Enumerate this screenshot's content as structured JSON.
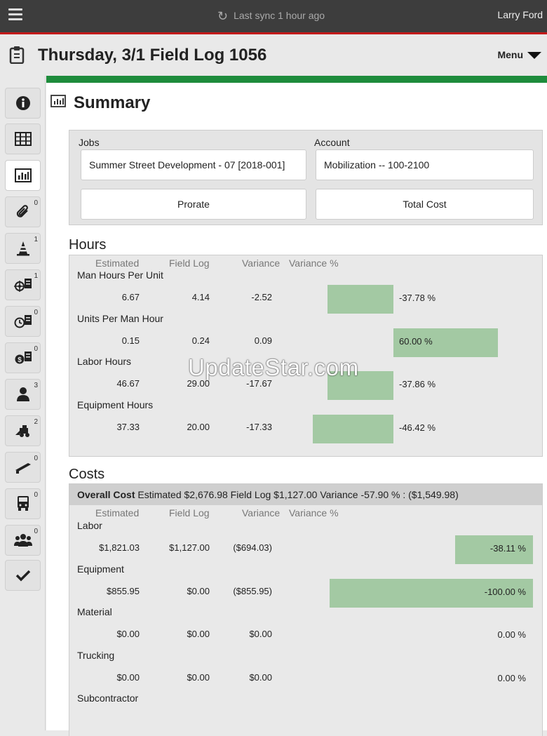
{
  "topbar": {
    "sync_text": "Last sync 1 hour ago",
    "user": "Larry Ford"
  },
  "header": {
    "title": "Thursday, 3/1 Field Log 1056",
    "menu_label": "Menu"
  },
  "sidebar": {
    "badges": [
      "0",
      "1",
      "1",
      "0",
      "0",
      "3",
      "2",
      "0",
      "0",
      "0"
    ]
  },
  "summary": {
    "title": "Summary"
  },
  "filters": {
    "jobs_label": "Jobs",
    "jobs_value": "Summer Street Development - 07 [2018-001]",
    "account_label": "Account",
    "account_value": "Mobilization -- 100-2100",
    "prorate_label": "Prorate",
    "total_cost_label": "Total Cost"
  },
  "columns": {
    "estimated": "Estimated",
    "field_log": "Field Log",
    "variance": "Variance",
    "variance_pct": "Variance %"
  },
  "hours": {
    "title": "Hours",
    "rows": [
      {
        "label": "Man Hours Per Unit",
        "estimated": "6.67",
        "field_log": "4.14",
        "variance": "-2.52",
        "pct": "-37.78 %",
        "pct_value": -37.78
      },
      {
        "label": "Units Per Man Hour",
        "estimated": "0.15",
        "field_log": "0.24",
        "variance": "0.09",
        "pct": "60.00 %",
        "pct_value": 60.0
      },
      {
        "label": "Labor Hours",
        "estimated": "46.67",
        "field_log": "29.00",
        "variance": "-17.67",
        "pct": "-37.86 %",
        "pct_value": -37.86
      },
      {
        "label": "Equipment Hours",
        "estimated": "37.33",
        "field_log": "20.00",
        "variance": "-17.33",
        "pct": "-46.42 %",
        "pct_value": -46.42
      }
    ]
  },
  "costs": {
    "title": "Costs",
    "overall_label": "Overall Cost",
    "overall_text": "Estimated $2,676.98 Field Log $1,127.00 Variance -57.90 % : ($1,549.98)",
    "rows": [
      {
        "label": "Labor",
        "estimated": "$1,821.03",
        "field_log": "$1,127.00",
        "variance": "($694.03)",
        "pct": "-38.11 %",
        "pct_value": -38.11
      },
      {
        "label": "Equipment",
        "estimated": "$855.95",
        "field_log": "$0.00",
        "variance": "($855.95)",
        "pct": "-100.00 %",
        "pct_value": -100.0
      },
      {
        "label": "Material",
        "estimated": "$0.00",
        "field_log": "$0.00",
        "variance": "$0.00",
        "pct": "0.00 %",
        "pct_value": 0
      },
      {
        "label": "Trucking",
        "estimated": "$0.00",
        "field_log": "$0.00",
        "variance": "$0.00",
        "pct": "0.00 %",
        "pct_value": 0
      },
      {
        "label": "Subcontractor"
      }
    ]
  },
  "watermark": "UpdateStar.com",
  "colors": {
    "topbar": "#3d3d3d",
    "accent_red": "#c21a1a",
    "accent_green": "#1e8c3c",
    "bar_green": "#a3c9a3"
  }
}
